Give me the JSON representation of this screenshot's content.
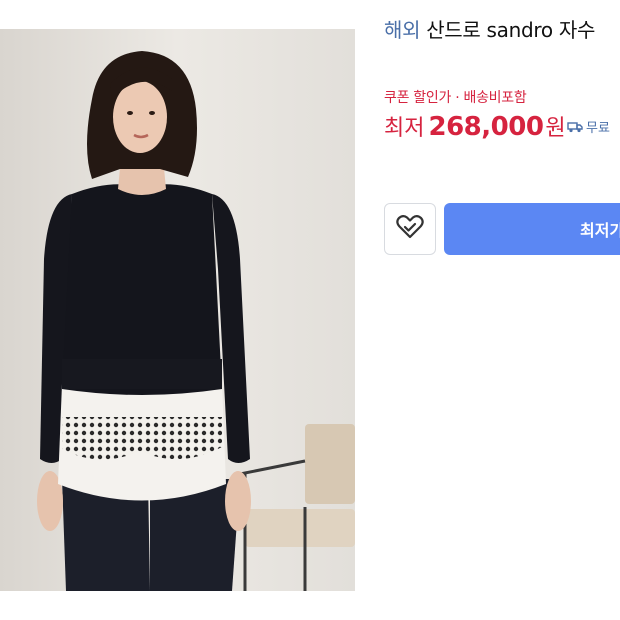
{
  "product": {
    "badge": "해외",
    "title": "산드로 sandro 자수",
    "coupon_note": "쿠폰 할인가 · 배송비포함",
    "price_label": "최저",
    "price_value": "268,000",
    "price_unit": "원",
    "shipping": "무료",
    "buy_label": "최저가",
    "image_icon": "product-photo"
  },
  "colors": {
    "accent": "#5b87f3",
    "price": "#d6233f",
    "badge": "#4a6fa8"
  }
}
